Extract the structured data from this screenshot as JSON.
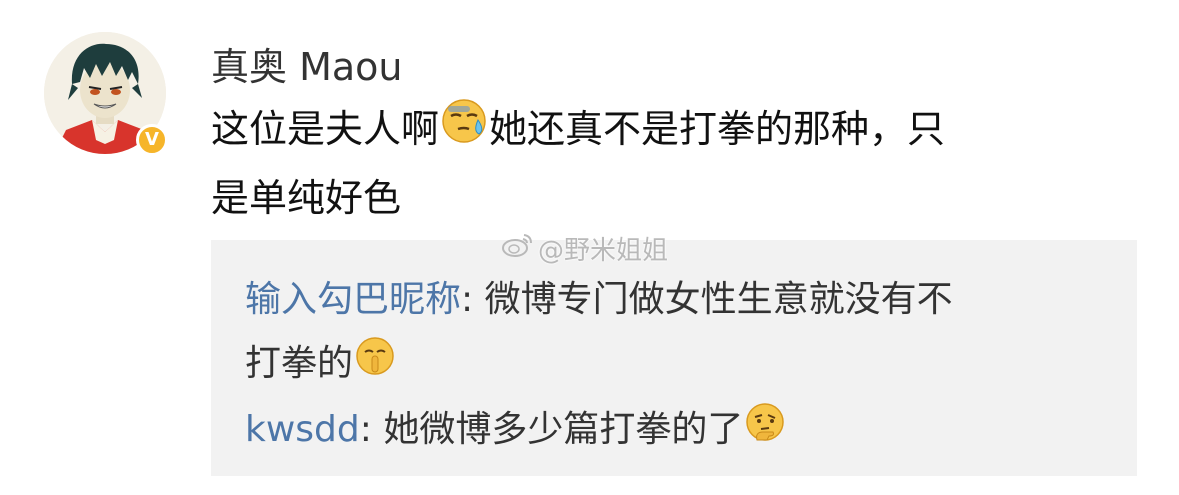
{
  "comment": {
    "username": "真奥 Maou",
    "badge": "V",
    "text_before_emoji": "这位是夫人啊",
    "emoji_1": "sweat-face-icon",
    "text_after_emoji_line1": "她还真不是打拳的那种，只",
    "text_line2": "是单纯好色"
  },
  "replies_box": {
    "watermark": "@野米姐姐",
    "replies": [
      {
        "username": "输入勾巴昵称",
        "separator": ": ",
        "text_line1": "微博专门做女性生意就没有不",
        "text_line2": "打拳的",
        "emoji": "shushing-face-icon"
      },
      {
        "username": "kwsdd",
        "separator": ": ",
        "text_line1": "她微博多少篇打拳的了",
        "emoji": "thinking-face-icon"
      }
    ]
  },
  "colors": {
    "reply_name": "#4d76a8",
    "reply_box_bg": "#f2f2f2",
    "badge": "#f6b52a",
    "text": "#111111"
  }
}
